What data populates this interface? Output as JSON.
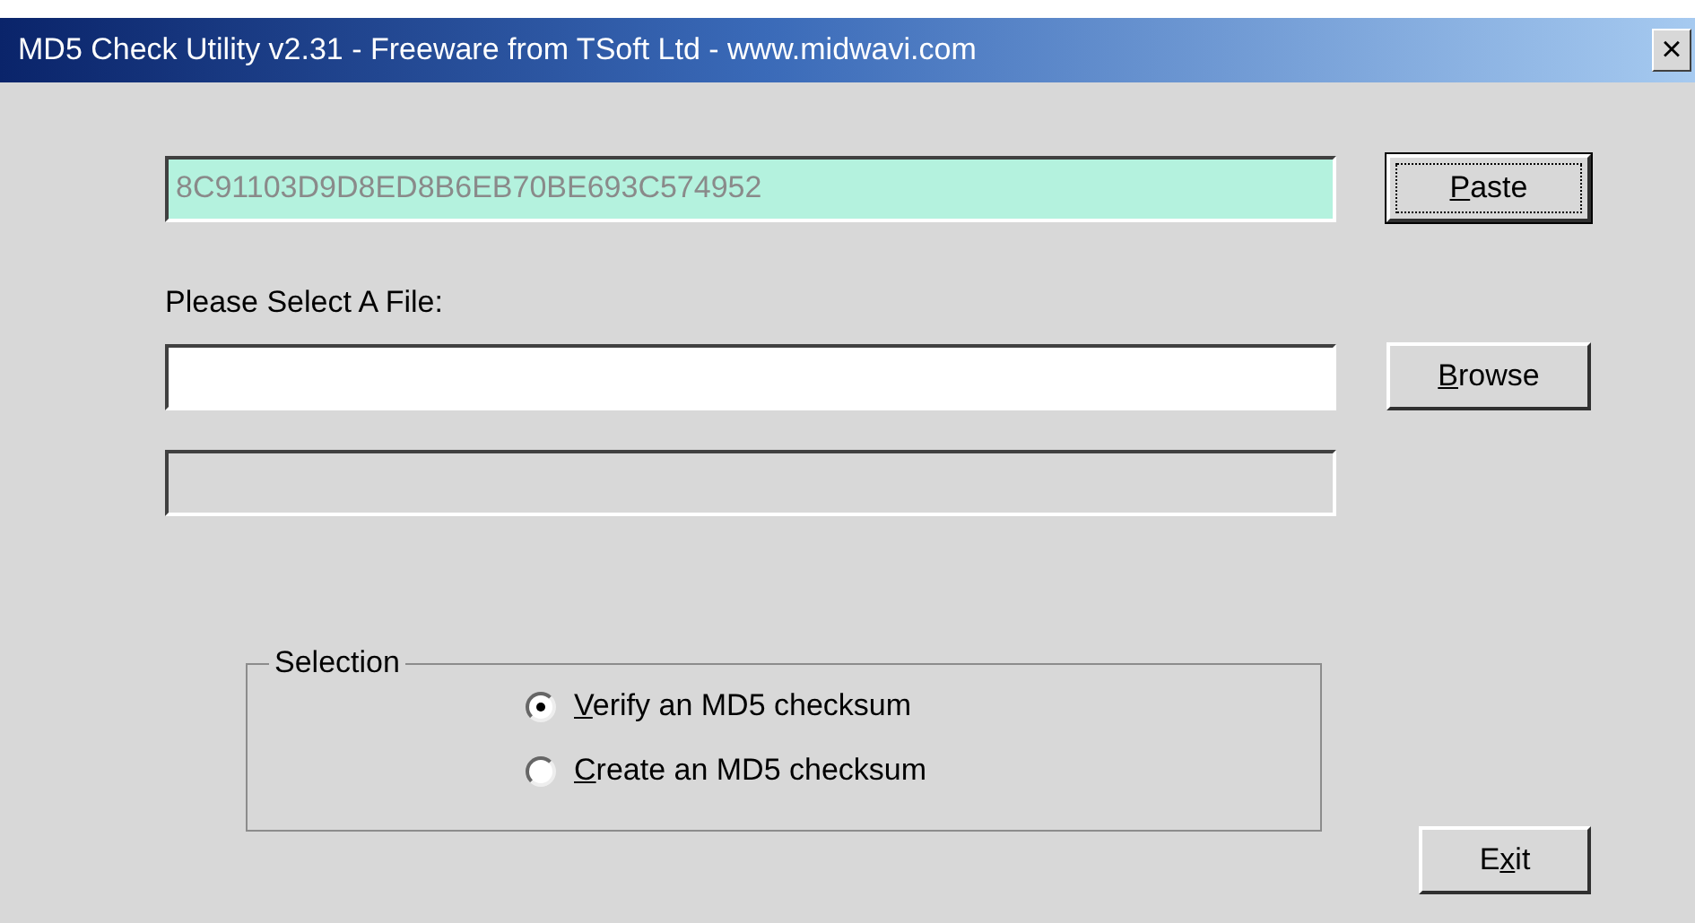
{
  "window": {
    "title": "MD5 Check Utility v2.31 - Freeware from TSoft Ltd - www.midwavi.com",
    "close": "×"
  },
  "hash_field": {
    "value": "8C91103D9D8ED8B6EB70BE693C574952"
  },
  "paste_button": {
    "key": "P",
    "post": "aste",
    "focused": true
  },
  "file_label": "Please Select A File:",
  "browse_button": {
    "key": "B",
    "post": "rowse",
    "focused": false
  },
  "status_field": {
    "disabled": true
  },
  "selection": {
    "legend": "Selection",
    "options": [
      {
        "key": "V",
        "post": "erify an MD5 checksum",
        "selected": true
      },
      {
        "key": "C",
        "post": "reate an MD5 checksum",
        "selected": false
      }
    ]
  },
  "exit_button": {
    "pre": "E",
    "key": "x",
    "post": "it",
    "focused": false
  }
}
